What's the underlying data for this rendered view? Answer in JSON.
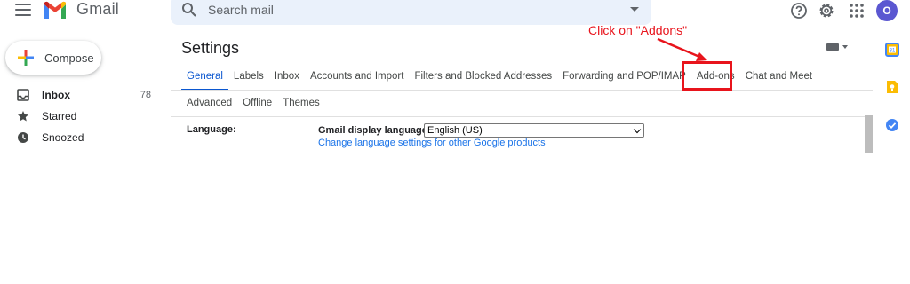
{
  "header": {
    "app_name": "Gmail",
    "search_placeholder": "Search mail",
    "avatar_initial": "O",
    "icons": [
      "menu-icon",
      "gmail-logo-icon",
      "search-icon",
      "search-options-icon",
      "help-icon",
      "settings-icon",
      "apps-icon",
      "avatar"
    ]
  },
  "sidebar": {
    "compose_label": "Compose",
    "items": [
      {
        "label": "Inbox",
        "count": "78",
        "icon": "inbox-icon",
        "bold": true
      },
      {
        "label": "Starred",
        "count": "",
        "icon": "star-icon",
        "bold": false
      },
      {
        "label": "Snoozed",
        "count": "",
        "icon": "clock-icon",
        "bold": false
      }
    ]
  },
  "settings": {
    "title": "Settings",
    "tabs_row1": [
      "General",
      "Labels",
      "Inbox",
      "Accounts and Import",
      "Filters and Blocked Addresses",
      "Forwarding and POP/IMAP",
      "Add-ons",
      "Chat and Meet"
    ],
    "tabs_row2": [
      "Advanced",
      "Offline",
      "Themes"
    ],
    "active_tab": "General",
    "language": {
      "section_label": "Language:",
      "field_label": "Gmail display language:",
      "selected_value": "English (US)",
      "link_text": "Change language settings for other Google products"
    }
  },
  "right_rail": {
    "icons": [
      "calendar-icon",
      "keep-icon",
      "tasks-icon"
    ]
  },
  "annotation": {
    "text": "Click on \"Addons\"",
    "color": "#e8141c"
  },
  "colors": {
    "accent": "#0b57d0",
    "search_bg": "#eaf1fb",
    "link": "#1a73e8",
    "avatar_bg": "#5b57d1"
  }
}
